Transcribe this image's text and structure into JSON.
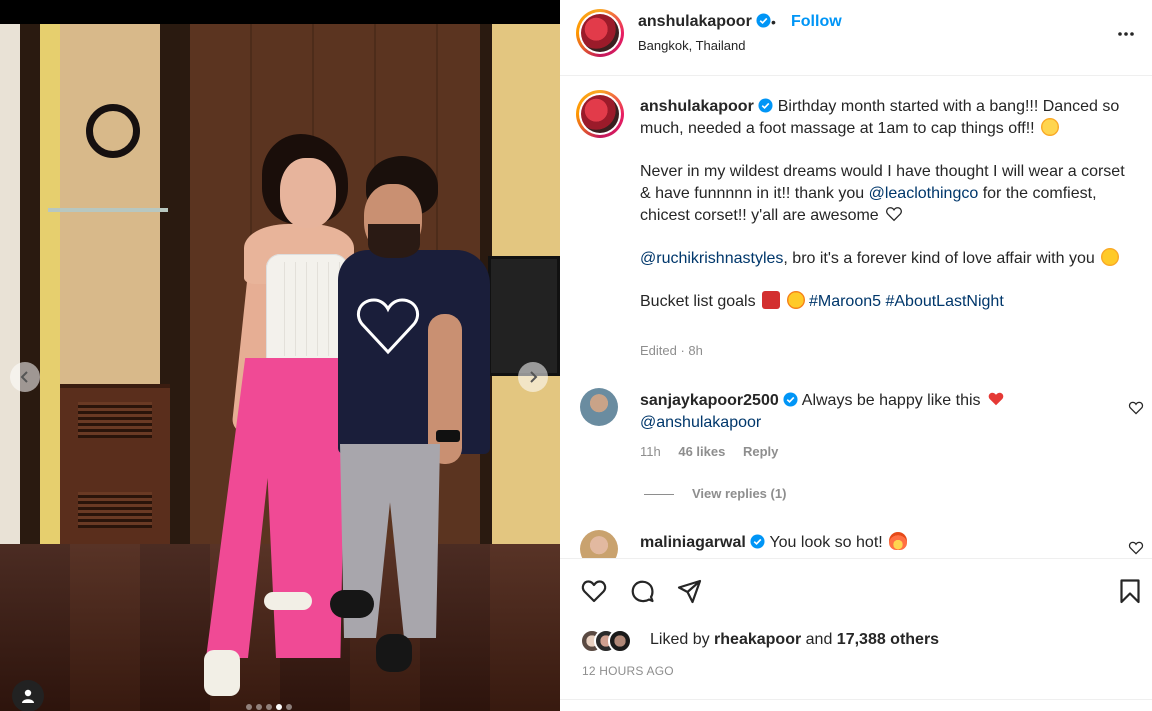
{
  "post": {
    "photo_alt": "",
    "carousel": {
      "count": 5,
      "active_index": 3
    }
  },
  "header": {
    "username": "anshulakapoor",
    "follow_label": "Follow",
    "separator": "•",
    "location": "Bangkok, Thailand",
    "more_icon": "more-icon"
  },
  "caption": {
    "username": "anshulakapoor",
    "line1": "Birthday month started with a bang!!! Danced so much, needed a foot massage at 1am to cap things off!!",
    "para2_a": "Never in my wildest dreams would I have thought I will wear a corset & have funnnnn in it!! thank you",
    "para2_mention": "@leaclothingco",
    "para2_b": "for the comfiest, chicest corset!! y'all are awesome",
    "para3_mention": "@ruchikrishnastyles",
    "para3_b": ", bro it's a forever kind of love affair with you",
    "para4_a": "Bucket list goals",
    "hashtag1": "#Maroon5",
    "hashtag2": "#AboutLastNight",
    "edited": "Edited · 8h"
  },
  "comments": [
    {
      "username": "sanjaykapoor2500",
      "text": "Always be happy like this",
      "mention": "@anshulakapoor",
      "time": "11h",
      "likes": "46 likes",
      "reply": "Reply",
      "view_replies": "View replies (1)"
    },
    {
      "username": "maliniagarwal",
      "text": "You look so hot!"
    }
  ],
  "actions": {
    "liked_by_prefix": "Liked by",
    "liked_by_user": "rheakapoor",
    "liked_by_and": "and",
    "liked_by_others": "17,388 others",
    "timestamp": "12 HOURS AGO"
  },
  "colors": {
    "accent": "#0095f6",
    "mention": "#00376b",
    "muted": "#8e8e8e",
    "text": "#262626"
  }
}
